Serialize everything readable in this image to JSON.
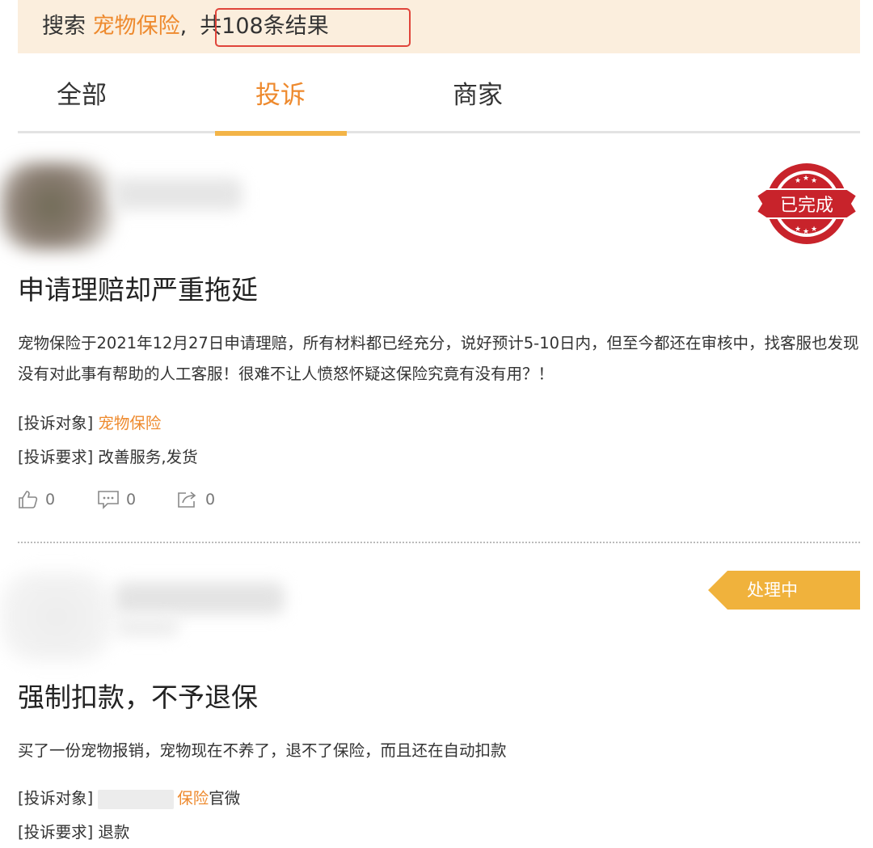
{
  "search": {
    "prefix": "搜索 ",
    "keyword": "宠物保险",
    "separator": ",",
    "count_text": "共108条结果"
  },
  "tabs": [
    {
      "label": "全部",
      "active": false
    },
    {
      "label": "投诉",
      "active": true
    },
    {
      "label": "商家",
      "active": false
    }
  ],
  "complaints": [
    {
      "status": "已完成",
      "title": "申请理赔却严重拖延",
      "body": "宠物保险于2021年12月27日申请理赔，所有材料都已经充分，说好预计5-10日内，但至今都还在审核中，找客服也发现没有对此事有帮助的人工客服！很难不让人愤怒怀疑这保险究竟有没有用？！",
      "target_label": "[投诉对象]",
      "target_value": "宠物保险",
      "request_label": "[投诉要求]",
      "request_value": "改善服务,发货",
      "likes": "0",
      "comments": "0",
      "shares": "0"
    },
    {
      "status": "处理中",
      "title": "强制扣款，不予退保",
      "body": "买了一份宠物报销，宠物现在不养了，退不了保险，而且还在自动扣款",
      "target_label": "[投诉对象]",
      "target_value": "保险",
      "target_suffix": "官微",
      "request_label": "[投诉要求]",
      "request_value": "退款"
    }
  ],
  "colors": {
    "accent": "#ee8a2e",
    "banner_bg": "#fbeedd",
    "highlight_border": "#e0443a",
    "tab_indicator": "#f3b447",
    "stamp_red": "#c8232b",
    "status_processing": "#f0b23c"
  },
  "icons": {
    "like": "thumbs-up-icon",
    "comment": "comment-icon",
    "share": "share-icon",
    "stamp": "completed-stamp-icon"
  }
}
